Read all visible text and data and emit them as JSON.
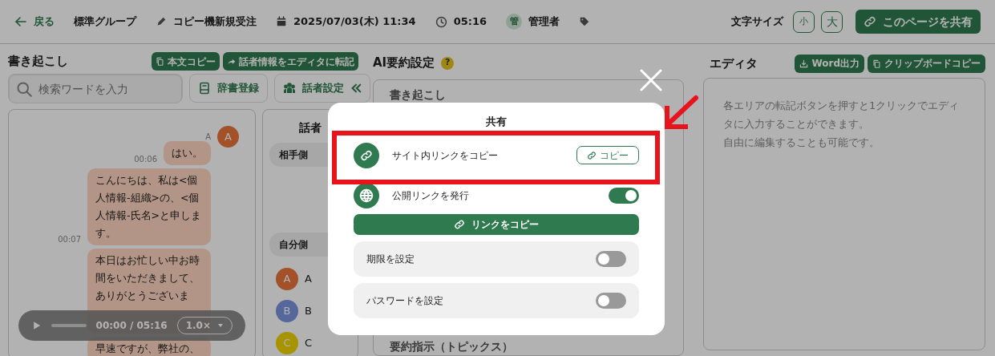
{
  "header": {
    "back": "戻る",
    "group": "標準グループ",
    "title": "コピー機新規受注",
    "datetime": "2025/07/03(木) 11:34",
    "duration": "05:16",
    "user": {
      "initial": "管",
      "name": "管理者"
    },
    "font_size_label": "文字サイズ",
    "font_sizes": [
      "小",
      "大"
    ],
    "share_button": "このページを共有"
  },
  "transcript": {
    "title": "書き起こし",
    "buttons": [
      "本文コピー",
      "話者情報をエディタに転記"
    ],
    "search": {
      "placeholder": "検索ワードを入力"
    },
    "dict_button": "辞書登録",
    "speaker_button": "話者設定",
    "messages": [
      {
        "speaker": {
          "label": "A",
          "initial": "A",
          "color": "#a25129"
        },
        "time": "00:06",
        "text": "はい。"
      },
      {
        "time": "00:07",
        "text": "こんにちは、私は<個人情報-組織>の、<個人情報-氏名>と申します。"
      },
      {
        "text": "本日はお忙しい中お時間をいただきまして、ありがとうございま"
      },
      {
        "text": "早速ですが、弊社の、"
      }
    ],
    "player": {
      "time": "00:00 / 05:16",
      "speed": "1.0×"
    }
  },
  "speakers": {
    "title": "話者",
    "groups": [
      "相手側",
      "自分側"
    ],
    "list": [
      {
        "initial": "A",
        "name": "A",
        "color": "#a25129"
      },
      {
        "initial": "B",
        "name": "B",
        "color": "#56679b"
      },
      {
        "initial": "C",
        "name": "C",
        "color": "#a89400"
      }
    ]
  },
  "ai_summary": {
    "title": "AI要約設定",
    "help": "?",
    "sections": [
      "書き起こし",
      "要約指示（トピックス）"
    ]
  },
  "editor": {
    "title": "エディタ",
    "buttons": [
      "Word出力",
      "クリップボードコピー"
    ],
    "text": [
      "各エリアの転記ボタンを押すと1クリックでエディタに入力することができます。",
      "自由に編集することも可能です。"
    ]
  },
  "modal": {
    "title": "共有",
    "site_link": {
      "label": "サイト内リンクをコピー",
      "button": "コピー"
    },
    "public_link": {
      "label": "公開リンクを発行",
      "on": true
    },
    "copy_button": "リンクをコピー",
    "options": [
      {
        "label": "期限を設定",
        "on": false
      },
      {
        "label": "パスワードを設定",
        "on": false
      }
    ]
  }
}
